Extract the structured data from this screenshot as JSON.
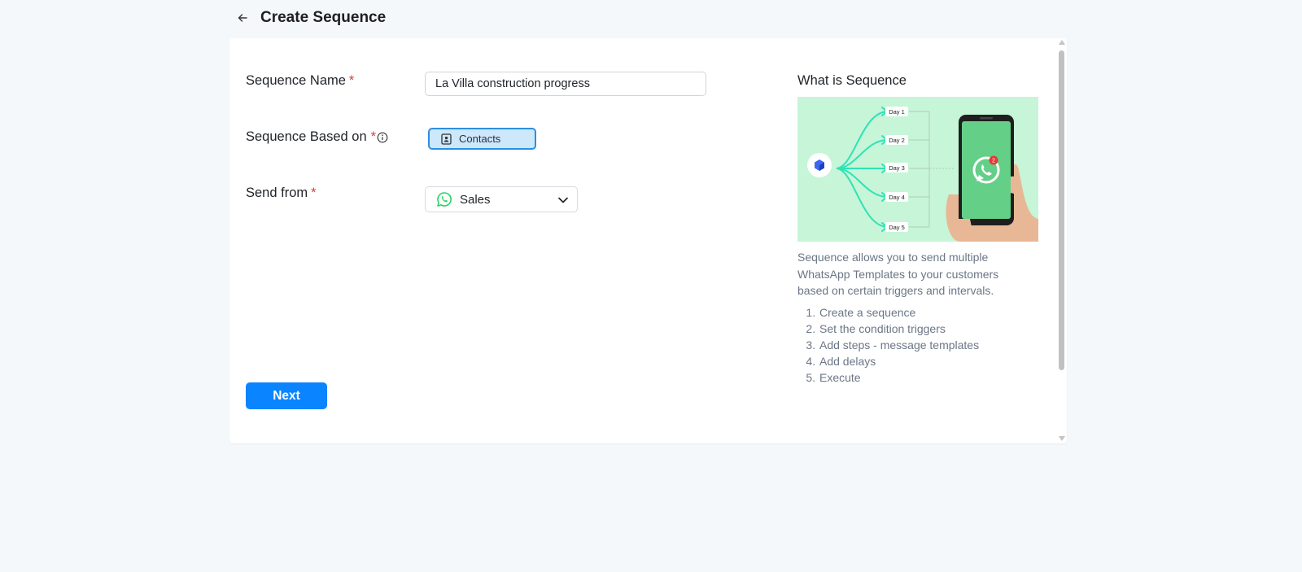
{
  "header": {
    "title": "Create Sequence"
  },
  "form": {
    "name_label": "Sequence Name",
    "name_value": "La Villa construction progress",
    "based_on_label": "Sequence Based on",
    "based_on_value": "Contacts",
    "send_from_label": "Send from",
    "send_from_value": "Sales",
    "required_mark": "*",
    "next_label": "Next"
  },
  "info": {
    "title": "What is Sequence",
    "description": "Sequence allows you to send multiple WhatsApp Templates to your customers based on certain triggers and intervals.",
    "steps": [
      "Create a sequence",
      "Set the condition triggers",
      "Add steps - message templates",
      "Add delays",
      "Execute"
    ],
    "illustration": {
      "days": [
        "Day 1",
        "Day 2",
        "Day 3",
        "Day 4",
        "Day 5"
      ],
      "badge": "2"
    }
  },
  "colors": {
    "accent": "#0a84ff",
    "chip_bg": "#cde7fb",
    "chip_border": "#2c8fe0",
    "required": "#e53935",
    "whatsapp": "#25d366",
    "illustration_bg": "#c6f5d8"
  },
  "icons": {
    "back": "arrow-left-icon",
    "info": "info-circle-icon",
    "contacts": "contact-book-icon",
    "whatsapp": "whatsapp-icon",
    "dropdown": "chevron-down-icon"
  }
}
